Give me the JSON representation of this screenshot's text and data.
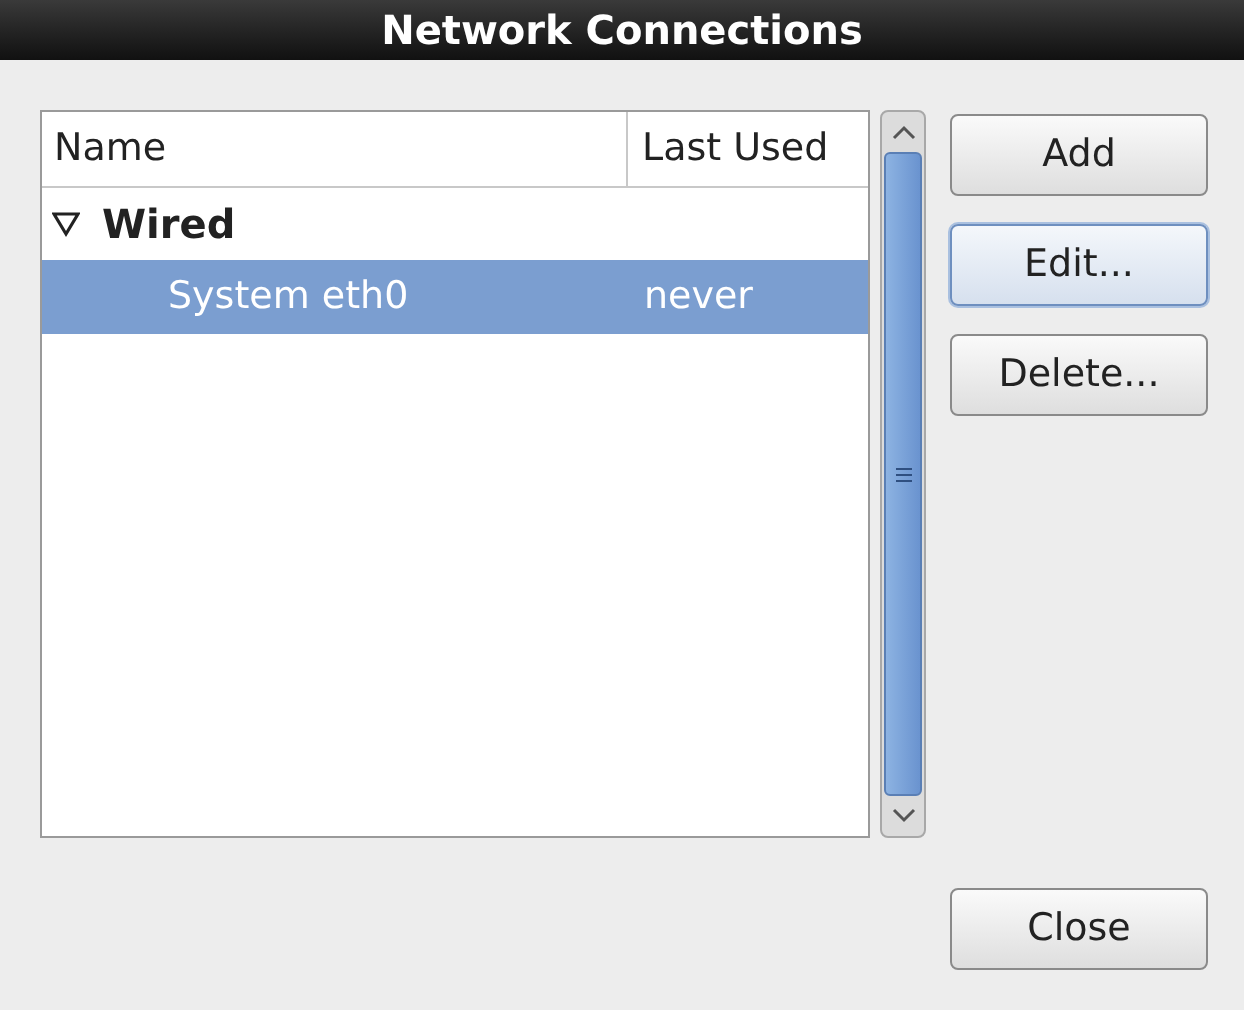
{
  "window": {
    "title": "Network Connections"
  },
  "table": {
    "columns": [
      "Name",
      "Last Used"
    ],
    "groups": [
      {
        "label": "Wired",
        "expanded": true,
        "rows": [
          {
            "name": "System eth0",
            "last_used": "never",
            "selected": true
          }
        ]
      }
    ]
  },
  "buttons": [
    {
      "label": "Add",
      "focused": false
    },
    {
      "label": "Edit...",
      "focused": true
    },
    {
      "label": "Delete...",
      "focused": false
    }
  ],
  "close_button": {
    "label": "Close"
  }
}
